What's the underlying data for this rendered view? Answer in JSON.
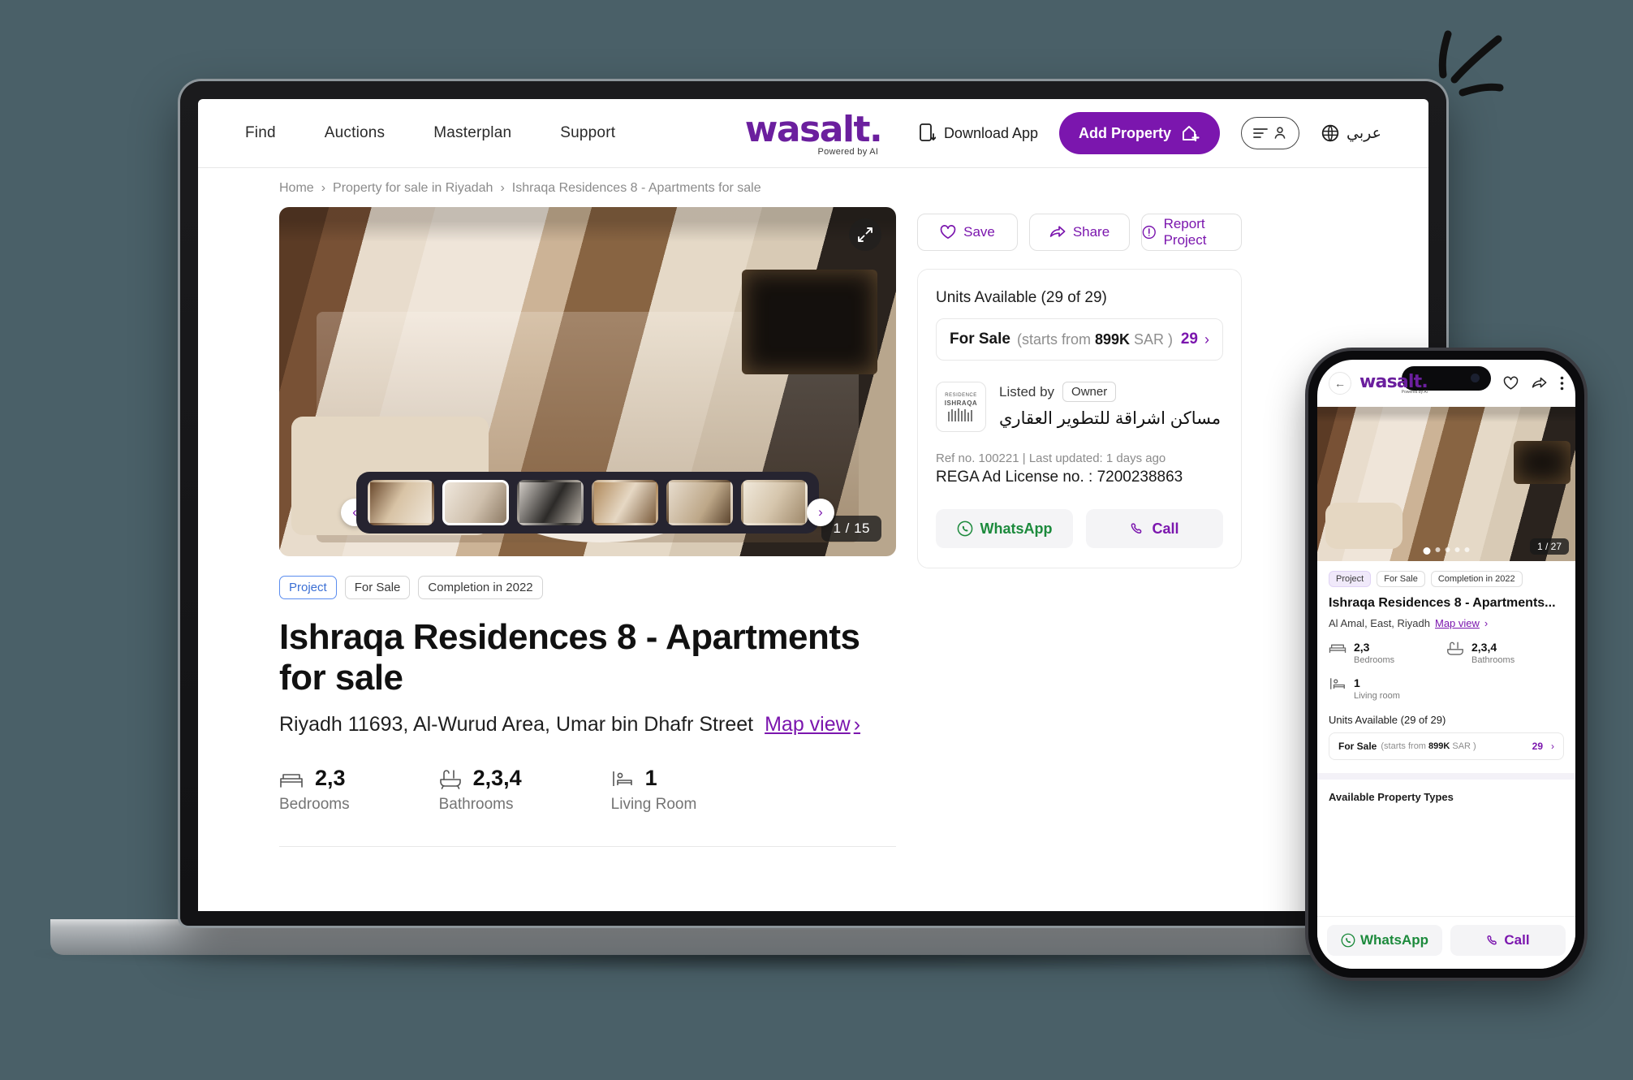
{
  "theme": {
    "accent": "#7b16ae",
    "brand_purple": "#6b1f9e",
    "whatsapp_green": "#1c8a3c",
    "background": "#4a6068",
    "tag_blue": "#3b6fd4"
  },
  "nav": {
    "links": [
      {
        "label": "Find",
        "name": "nav-link-find"
      },
      {
        "label": "Auctions",
        "name": "nav-link-auctions"
      },
      {
        "label": "Masterplan",
        "name": "nav-link-masterplan"
      },
      {
        "label": "Support",
        "name": "nav-link-support"
      }
    ],
    "brand": {
      "word": "wasalt.",
      "tagline": "Powered by AI"
    },
    "download_app": "Download App",
    "add_property": "Add Property",
    "language": "عربي"
  },
  "breadcrumb": {
    "items": [
      "Home",
      "Property for sale in Riyadah",
      "Ishraqa Residences 8 - Apartments for sale"
    ],
    "separator": "›"
  },
  "gallery": {
    "counter": "1 / 15",
    "prev": "‹",
    "next": "›",
    "thumbs": [
      "thumb-1",
      "thumb-2",
      "thumb-3",
      "thumb-4",
      "thumb-5",
      "thumb-6"
    ],
    "active_thumb_index": 1
  },
  "listing": {
    "tags": [
      "Project",
      "For Sale",
      "Completion in 2022"
    ],
    "title": "Ishraqa Residences 8 - Apartments for sale",
    "address": "Riyadh 11693, Al-Wurud Area, Umar bin Dhafr Street",
    "map_view": "Map view",
    "map_chevron": "›",
    "facts": [
      {
        "value": "2,3",
        "label": "Bedrooms",
        "icon": "bed-icon"
      },
      {
        "value": "2,3,4",
        "label": "Bathrooms",
        "icon": "bathtub-icon"
      },
      {
        "value": "1",
        "label": "Living Room",
        "icon": "living-room-icon"
      }
    ]
  },
  "sidebar": {
    "actions": [
      {
        "label": "Save",
        "icon": "heart-icon"
      },
      {
        "label": "Share",
        "icon": "share-icon"
      },
      {
        "label": "Report Project",
        "icon": "alert-circle-icon"
      }
    ],
    "units_title": "Units Available (29 of 29)",
    "unit_row": {
      "type": "For Sale",
      "price_note": "(starts from ",
      "price": "899K",
      "currency": " SAR )",
      "count": "29",
      "chevron": "›"
    },
    "lister": {
      "listed_by_label": "Listed by",
      "owner_chip": "Owner",
      "name": "مساكن اشراقة للتطوير العقاري",
      "logo_line1": "RESIDENCE",
      "logo_line2": "ISHRAQA",
      "logo_arabic": "إشــراقــة"
    },
    "ref_line": "Ref no. 100221 | Last updated: 1 days ago",
    "rega": "REGA Ad License no. : 7200238863",
    "cta": [
      {
        "label": "WhatsApp",
        "icon": "whatsapp-icon"
      },
      {
        "label": "Call",
        "icon": "phone-icon"
      }
    ]
  },
  "phone": {
    "brand": {
      "word": "wasalt.",
      "tagline": "Powered by AI"
    },
    "back": "←",
    "header_icons": [
      "heart-icon",
      "share-icon",
      "more-vertical-icon"
    ],
    "counter": "1 / 27",
    "tags": [
      "Project",
      "For Sale",
      "Completion in 2022"
    ],
    "title": "Ishraqa Residences 8 - Apartments...",
    "address": "Al Amal, East, Riyadh",
    "map_view": "Map view",
    "map_chevron": "›",
    "facts": [
      {
        "value": "2,3",
        "label": "Bedrooms",
        "icon": "bed-icon"
      },
      {
        "value": "2,3,4",
        "label": "Bathrooms",
        "icon": "bathtub-icon"
      },
      {
        "value": "1",
        "label": "Living room",
        "icon": "living-room-icon"
      }
    ],
    "units_title": "Units Available (29 of 29)",
    "unit_row": {
      "type": "For Sale",
      "price_note": "(starts from ",
      "price": "899K",
      "currency": " SAR )",
      "count": "29",
      "chevron": "›"
    },
    "section_title": "Available Property Types",
    "cta": [
      {
        "label": "WhatsApp",
        "icon": "whatsapp-icon"
      },
      {
        "label": "Call",
        "icon": "phone-icon"
      }
    ]
  }
}
